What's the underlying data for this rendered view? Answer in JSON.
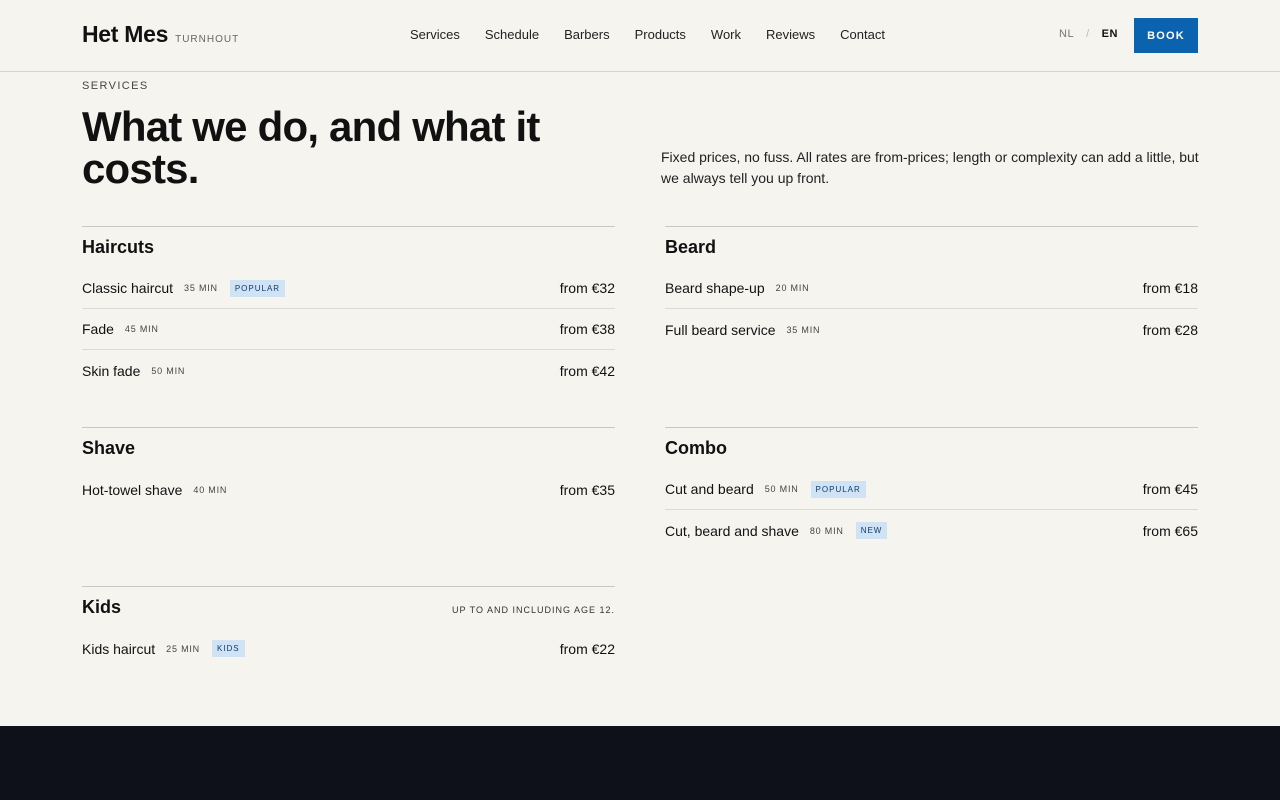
{
  "header": {
    "brand": "Het Mes",
    "location": "TURNHOUT",
    "nav": [
      "Services",
      "Schedule",
      "Barbers",
      "Products",
      "Work",
      "Reviews",
      "Contact"
    ],
    "lang_nl": "NL",
    "lang_sep": "/",
    "lang_en": "EN",
    "book_label": "BOOK"
  },
  "intro": {
    "eyebrow": "SERVICES",
    "title": "What we do, and what it costs.",
    "lede": "Fixed prices, no fuss. All rates are from-prices; length or complexity can add a little, but we always tell you up front."
  },
  "colors": {
    "accent": "#0b63b0",
    "badge_bg": "#cfe3f5",
    "footer": "#0f111a",
    "background": "#f5f4ef"
  },
  "sections": [
    {
      "title": "Haircuts",
      "note": "",
      "items": [
        {
          "name": "Classic haircut",
          "duration": "35 MIN",
          "badge": "POPULAR",
          "price": "from €32"
        },
        {
          "name": "Fade",
          "duration": "45 MIN",
          "badge": "",
          "price": "from €38"
        },
        {
          "name": "Skin fade",
          "duration": "50 MIN",
          "badge": "",
          "price": "from €42"
        }
      ]
    },
    {
      "title": "Beard",
      "note": "",
      "items": [
        {
          "name": "Beard shape-up",
          "duration": "20 MIN",
          "badge": "",
          "price": "from €18"
        },
        {
          "name": "Full beard service",
          "duration": "35 MIN",
          "badge": "",
          "price": "from €28"
        }
      ]
    },
    {
      "title": "Shave",
      "note": "",
      "items": [
        {
          "name": "Hot-towel shave",
          "duration": "40 MIN",
          "badge": "",
          "price": "from €35"
        }
      ]
    },
    {
      "title": "Combo",
      "note": "",
      "items": [
        {
          "name": "Cut and beard",
          "duration": "50 MIN",
          "badge": "POPULAR",
          "price": "from €45"
        },
        {
          "name": "Cut, beard and shave",
          "duration": "80 MIN",
          "badge": "NEW",
          "price": "from €65"
        }
      ]
    },
    {
      "title": "Kids",
      "note": "UP TO AND INCLUDING AGE 12.",
      "items": [
        {
          "name": "Kids haircut",
          "duration": "25 MIN",
          "badge": "KIDS",
          "price": "from €22"
        }
      ]
    }
  ]
}
